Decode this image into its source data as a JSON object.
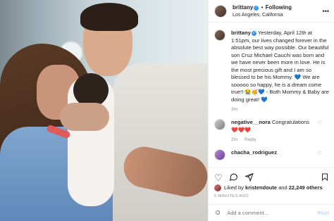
{
  "header": {
    "username": "brittany",
    "separator": "•",
    "follow_label": "Following",
    "location": "Los Angeles, California",
    "more_icon": "more-horizontal-icon"
  },
  "caption": {
    "username": "brittany",
    "text": "Yesterday, April 12th at 1:51pm, our lives changed forever in the absolute best way possible. Our beautiful son Cruz Michael Cauchi was born and we have never been more in love. He is the most precious gift and I am so blessed to be his Mommy. 💙 We are sooooo so happy, he is a dream come true!! 😭🥳💙 - Both Mommy & Baby are doing great! 💙",
    "age": "3m"
  },
  "comments": [
    {
      "username": "negative__nora",
      "text": "Congratulations",
      "emojis": "❤️❤️❤️",
      "age": "2m",
      "reply_label": "Reply"
    },
    {
      "username": "chacha_rodriguez",
      "text": ""
    }
  ],
  "actions": {
    "like_icon": "heart-icon",
    "comment_icon": "comment-icon",
    "share_icon": "share-icon",
    "save_icon": "bookmark-icon"
  },
  "likes": {
    "prefix": "Liked by",
    "user": "kristendoute",
    "connector": "and",
    "others": "22,249 others"
  },
  "timestamp": "5 MINUTES AGO",
  "add_comment": {
    "placeholder": "Add a comment…",
    "post_label": "Post"
  },
  "colors": {
    "verified": "#3897f0",
    "post_disabled": "#b3dbff",
    "muted": "#8e8e8e"
  }
}
